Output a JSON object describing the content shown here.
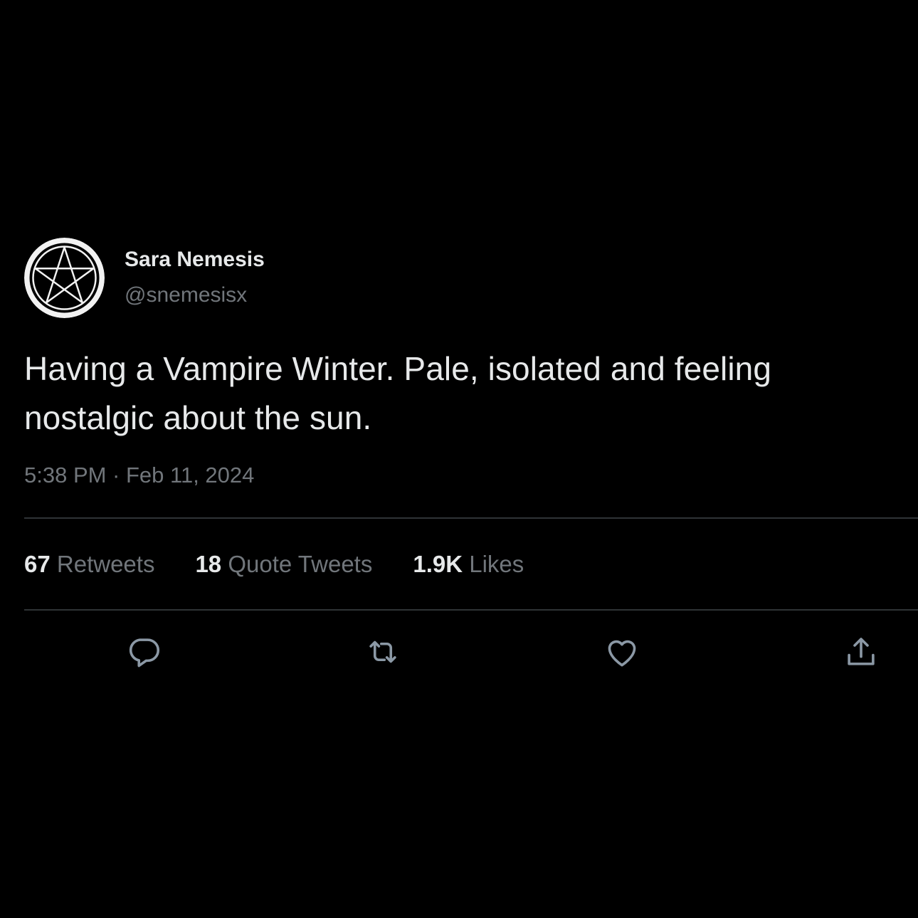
{
  "user": {
    "display_name": "Sara Nemesis",
    "handle": "@snemesisx",
    "avatar_icon": "pentagram-icon"
  },
  "tweet": {
    "text": "Having a Vampire Winter. Pale, isolated and feeling nostalgic about the sun.",
    "timestamp": "5:38 PM · Feb 11, 2024"
  },
  "stats": {
    "retweets": {
      "count": "67",
      "label": "Retweets"
    },
    "quotes": {
      "count": "18",
      "label": "Quote Tweets"
    },
    "likes": {
      "count": "1.9K",
      "label": "Likes"
    }
  },
  "actions": {
    "reply_icon": "reply-icon",
    "retweet_icon": "retweet-icon",
    "like_icon": "heart-icon",
    "share_icon": "share-icon"
  },
  "colors": {
    "background": "#000000",
    "text_primary": "#e7e9ea",
    "text_secondary": "#71767b",
    "divider": "#2f3336"
  }
}
